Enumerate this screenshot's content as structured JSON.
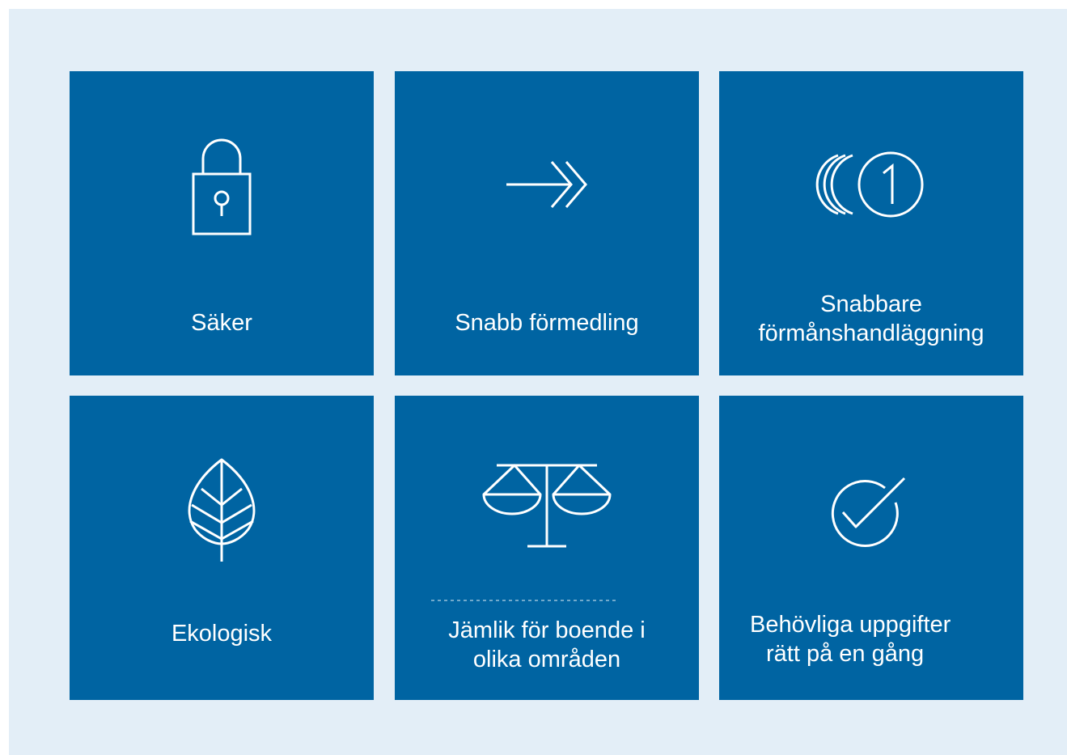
{
  "colors": {
    "background": "#e3eef7",
    "tile": "#0064a2",
    "foreground": "#ffffff"
  },
  "tiles": [
    {
      "icon": "padlock-icon",
      "lines": [
        "Säker"
      ]
    },
    {
      "icon": "double-arrow-icon",
      "lines": [
        "Snabb förmedling"
      ]
    },
    {
      "icon": "first-place-circle-icon",
      "lines": [
        "Snabbare",
        "förmånshandläggning"
      ]
    },
    {
      "icon": "leaf-icon",
      "lines": [
        "Ekologisk"
      ]
    },
    {
      "icon": "scales-icon",
      "lines": [
        "Jämlik för boende i",
        "olika områden"
      ]
    },
    {
      "icon": "check-circle-icon",
      "lines": [
        "Behövliga uppgifter",
        "rätt på en gång"
      ]
    }
  ]
}
